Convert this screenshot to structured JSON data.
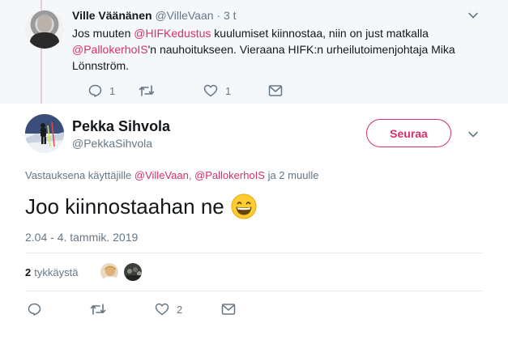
{
  "parent_tweet": {
    "name": "Ville Väänänen",
    "handle": "@VilleVaan",
    "dot": "·",
    "time": "3 t",
    "text_1": "Jos muuten ",
    "mention_1": "@HIFKedustus",
    "text_2": " kuulumiset kiinnostaa, niin on just matkalla ",
    "mention_2": "@PallokerhoIS",
    "text_3": "'n nauhoitukseen. Vieraana HIFK:n urheilutoimenjohtaja Mika Lönnström.",
    "actions": {
      "replies": "1",
      "retweets": "",
      "likes": "1"
    }
  },
  "main_tweet": {
    "name": "Pekka Sihvola",
    "handle": "@PekkaSihvola",
    "follow_label": "Seuraa",
    "reply_prefix": "Vastauksena käyttäjille ",
    "reply_mention_1": "@VilleVaan",
    "reply_sep": ", ",
    "reply_mention_2": "@PallokerhoIS",
    "reply_suffix": " ja 2 muulle",
    "text": "Joo kiinnostaahan ne",
    "timestamp": "2.04 - 4. tammik. 2019",
    "likes_count": "2",
    "likes_label": "tykkäystä",
    "actions": {
      "replies": "",
      "retweets": "",
      "likes": "2"
    }
  },
  "icons": [
    "chevron-down-icon",
    "reply-icon",
    "retweet-icon",
    "heart-icon",
    "message-icon",
    "grinning-emoji-icon"
  ],
  "colors": {
    "accent": "#d82f65",
    "muted": "#657786",
    "text": "#14171a",
    "parent_bg": "#f5f8fa"
  }
}
